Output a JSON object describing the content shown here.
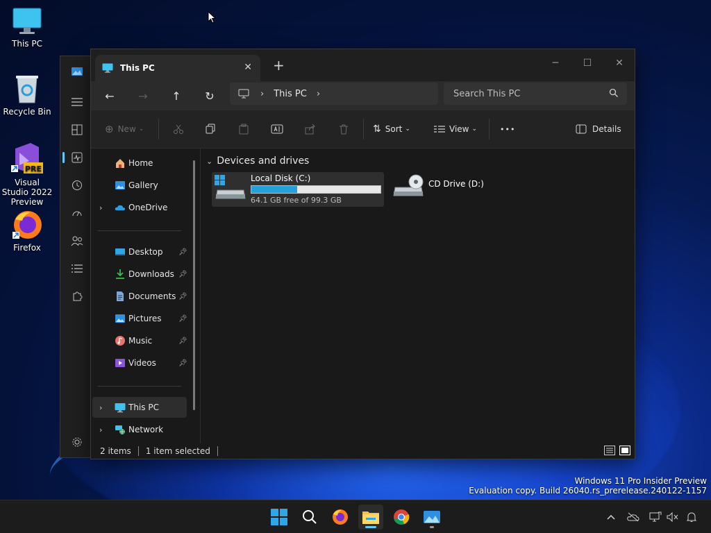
{
  "desktop": {
    "icons": [
      {
        "label": "This PC"
      },
      {
        "label": "Recycle Bin"
      },
      {
        "label": "Visual Studio 2022 Preview",
        "badge": "PRE"
      },
      {
        "label": "Firefox"
      }
    ]
  },
  "explorer": {
    "tab_title": "This PC",
    "address": {
      "segment": "This PC"
    },
    "search": {
      "placeholder": "Search This PC"
    },
    "commands": {
      "new": "New",
      "sort": "Sort",
      "view": "View",
      "more": "•••",
      "details": "Details"
    },
    "nav": {
      "home": "Home",
      "gallery": "Gallery",
      "onedrive": "OneDrive",
      "desktop": "Desktop",
      "downloads": "Downloads",
      "documents": "Documents",
      "pictures": "Pictures",
      "music": "Music",
      "videos": "Videos",
      "this_pc": "This PC",
      "network": "Network"
    },
    "group_header": "Devices and drives",
    "drives": [
      {
        "name": "Local Disk (C:)",
        "free_text": "64.1 GB free of 99.3 GB",
        "used_fraction": 0.354
      },
      {
        "name": "CD Drive (D:)"
      }
    ],
    "status": {
      "items": "2 items",
      "selected": "1 item selected"
    }
  },
  "watermark": {
    "line1": "Windows 11 Pro Insider Preview",
    "line2": "Evaluation copy. Build 26040.rs_prerelease.240122-1157"
  },
  "colors": {
    "accent": "#60cdff",
    "drive_fill": "#26a0da",
    "window_bg": "#191919"
  }
}
